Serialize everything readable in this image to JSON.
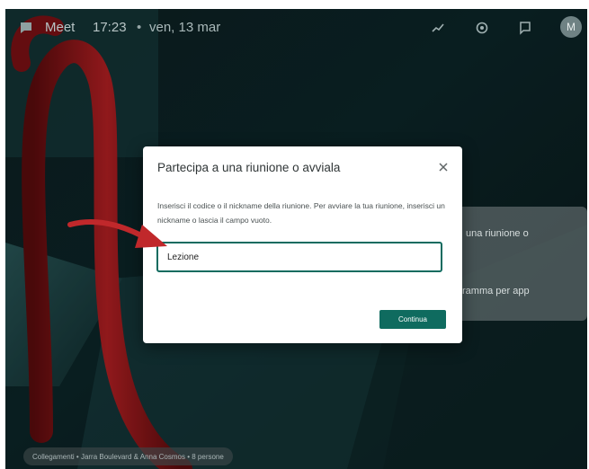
{
  "topbar": {
    "app_name": "Meet",
    "time": "17:23",
    "separator": "•",
    "date": "ven, 13 mar",
    "icons": [
      "chat-icon",
      "activity-icon",
      "settings-icon",
      "feedback-icon",
      "avatar"
    ],
    "avatar_letter": "M"
  },
  "side_panel": {
    "line1": "una riunione o",
    "line2": "ramma per app"
  },
  "bottom_bar": {
    "caption": "Collegamenti • Jarra Boulevard & Anna Cosmos • 8 persone"
  },
  "dialog": {
    "title": "Partecipa a una riunione o avviala",
    "description": "Inserisci il codice o il nickname della riunione. Per avviare la tua riunione, inserisci un nickname o lascia il campo vuoto.",
    "input_value": "Lezione",
    "continue_label": "Continua"
  },
  "colors": {
    "accent": "#0f6b5f",
    "annotation_arrow": "#c0282b",
    "background": "#0c2528"
  }
}
